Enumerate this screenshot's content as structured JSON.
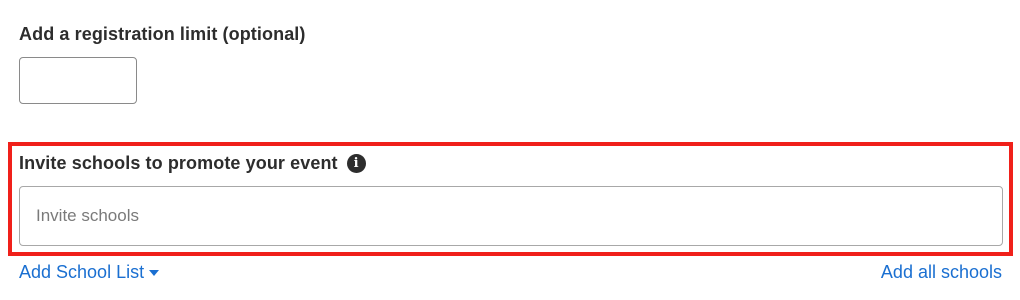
{
  "registration": {
    "label": "Add a registration limit (optional)",
    "value": ""
  },
  "invite": {
    "label": "Invite schools to promote your event",
    "info_icon": "i",
    "placeholder": "Invite schools",
    "highlight_color": "#f0201a"
  },
  "actions": {
    "add_school_list": "Add School List",
    "add_all_schools": "Add all schools",
    "link_color": "#1a6fd1"
  }
}
